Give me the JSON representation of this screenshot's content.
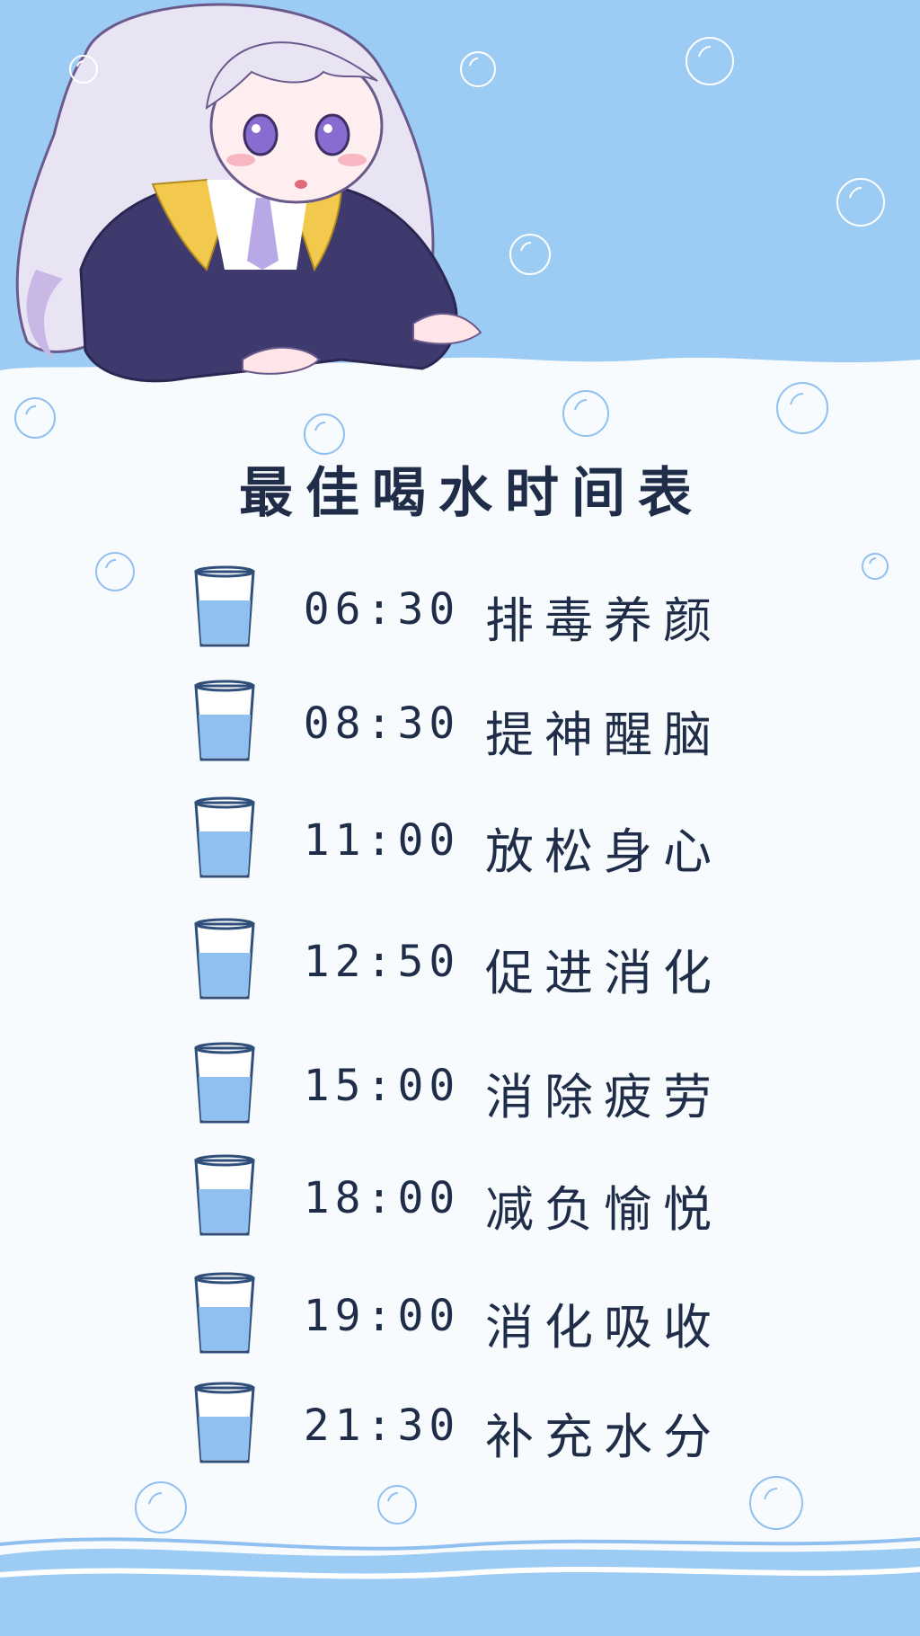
{
  "title": "最佳喝水时间表",
  "schedule": [
    {
      "time": "06:30",
      "label": "排毒养颜"
    },
    {
      "time": "08:30",
      "label": "提神醒脑"
    },
    {
      "time": "11:00",
      "label": "放松身心"
    },
    {
      "time": "12:50",
      "label": "促进消化"
    },
    {
      "time": "15:00",
      "label": "消除疲劳"
    },
    {
      "time": "18:00",
      "label": "减负愉悦"
    },
    {
      "time": "19:00",
      "label": "消化吸收"
    },
    {
      "time": "21:30",
      "label": "补充水分"
    }
  ],
  "colors": {
    "sky": "#9ccbf4",
    "water": "#8fc0ef",
    "text": "#1f2d48",
    "paper": "#f8fbfe"
  },
  "icons": {
    "cup": "water-glass-icon",
    "bubble": "bubble-icon"
  }
}
